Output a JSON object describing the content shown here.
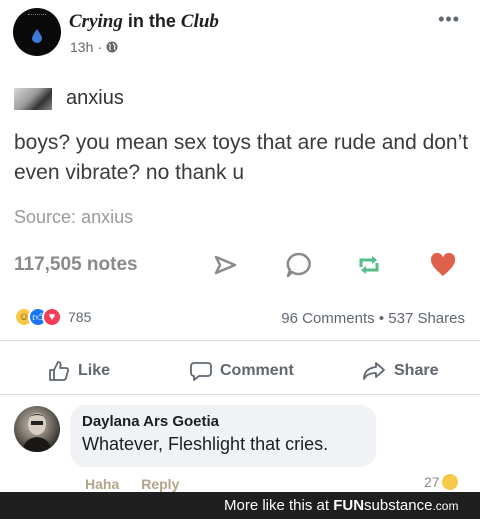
{
  "header": {
    "page_name_part1": "Crying",
    "page_name_part2": "in the",
    "page_name_part3": "Club",
    "time": "13h",
    "separator": "·",
    "visibility_icon": "globe-icon",
    "more_icon": "more-options-icon"
  },
  "tumblr_post": {
    "username": "anxius",
    "text": "boys? you mean sex toys that are rude and don’t even vibrate? no thank u",
    "source_label": "Source:",
    "source_name": "anxius",
    "notes": "117,505 notes",
    "actions": [
      {
        "icon": "share-arrow-icon"
      },
      {
        "icon": "reply-bubble-icon"
      },
      {
        "icon": "reblog-icon",
        "color": "#56bc8a"
      },
      {
        "icon": "heart-icon",
        "color": "#e0614a"
      }
    ]
  },
  "reactions": {
    "icons": [
      "haha-icon",
      "like-icon",
      "love-icon"
    ],
    "count": "785",
    "comments": "96 Comments",
    "dot": "•",
    "shares": "537 Shares"
  },
  "actions": {
    "like": "Like",
    "comment": "Comment",
    "share": "Share"
  },
  "comment": {
    "author": "Daylana Ars Goetia",
    "text": "Whatever, Fleshlight that cries.",
    "haha": "Haha",
    "reply": "Reply",
    "reaction_count": "27"
  },
  "footer": {
    "text": "More like this at",
    "brand_bold": "FUN",
    "brand_rest": "substance",
    "brand_suffix": ".com"
  },
  "colors": {
    "facebook_text": "#1c1e21",
    "muted": "#606770",
    "reblog_green": "#56bc8a",
    "heart_red": "#e0614a",
    "footer_bg": "#1f1f1f"
  }
}
